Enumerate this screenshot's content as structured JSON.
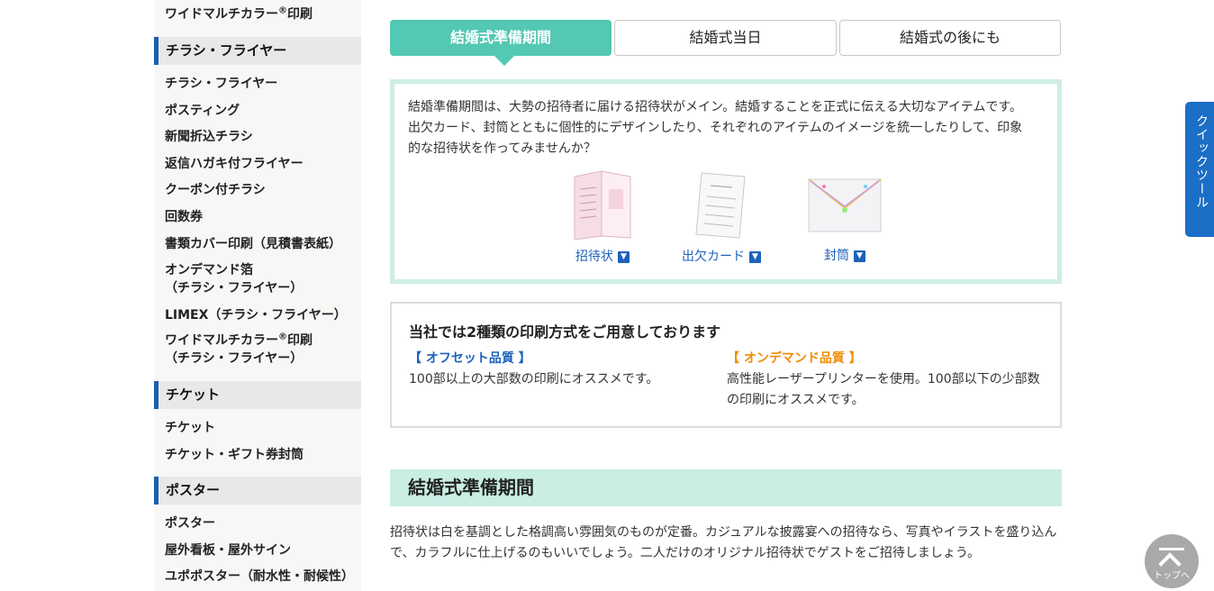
{
  "sidebar": {
    "top_item": {
      "label_pre": "ワイドマルチカラー",
      "mark": "®",
      "label_post": "印刷"
    },
    "sections": [
      {
        "title": "チラシ・フライヤー",
        "items": [
          "チラシ・フライヤー",
          "ポスティング",
          "新聞折込チラシ",
          "返信ハガキ付フライヤー",
          "クーポン付チラシ",
          "回数券",
          "書類カバー印刷（見積書表紙）",
          "オンデマンド箔",
          "（チラシ・フライヤー）",
          "LIMEX（チラシ・フライヤー）",
          "（チラシ・フライヤー）"
        ],
        "wide_label_pre": "ワイドマルチカラー",
        "wide_mark": "®",
        "wide_label_post": "印刷"
      },
      {
        "title": "チケット",
        "items": [
          "チケット",
          "チケット・ギフト券封筒"
        ]
      },
      {
        "title": "ポスター",
        "items": [
          "ポスター",
          "屋外看板・屋外サイン",
          "ユポポスター（耐水性・耐候性）"
        ]
      }
    ]
  },
  "tabs": [
    "結婚式準備期間",
    "結婚式当日",
    "結婚式の後にも"
  ],
  "intro": {
    "text": "結婚準備期間は、大勢の招待者に届ける招待状がメイン。結婚することを正式に伝える大切なアイテムです。出欠カード、封筒とともに個性的にデザインしたり、それぞれのアイテムのイメージを統一したりして、印象的な招待状を作ってみませんか？",
    "items": [
      {
        "label": "招待状",
        "icon": "download-icon"
      },
      {
        "label": "出欠カード",
        "icon": "download-icon"
      },
      {
        "label": "封筒",
        "icon": "download-icon"
      }
    ]
  },
  "methods": {
    "title": "当社では2種類の印刷方式をご用意しております",
    "offset": {
      "label": "【 オフセット品質 】",
      "desc": "100部以上の大部数の印刷にオススメです。",
      "color": "#1c62b9"
    },
    "ondemand": {
      "label": "【 オンデマンド品質 】",
      "desc": "高性能レーザープリンターを使用。100部以下の少部数の印刷にオススメです。",
      "color": "#f08c00"
    }
  },
  "section": {
    "title": "結婚式準備期間",
    "body": "招待状は白を基調とした格調高い雰囲気のものが定番。カジュアルな披露宴への招待なら、写真やイラストを盛り込んで、カラフルに仕上げるのもいいでしょう。二人だけのオリジナル招待状でゲストをご招待しましょう。"
  },
  "quick_tool": "クイックツール",
  "to_top": "トップへ",
  "colors": {
    "accent": "#53c8b3",
    "tab_border": "#c8c8c8",
    "sidebar_marker": "#1c5fb0",
    "link": "#1c62b9"
  }
}
